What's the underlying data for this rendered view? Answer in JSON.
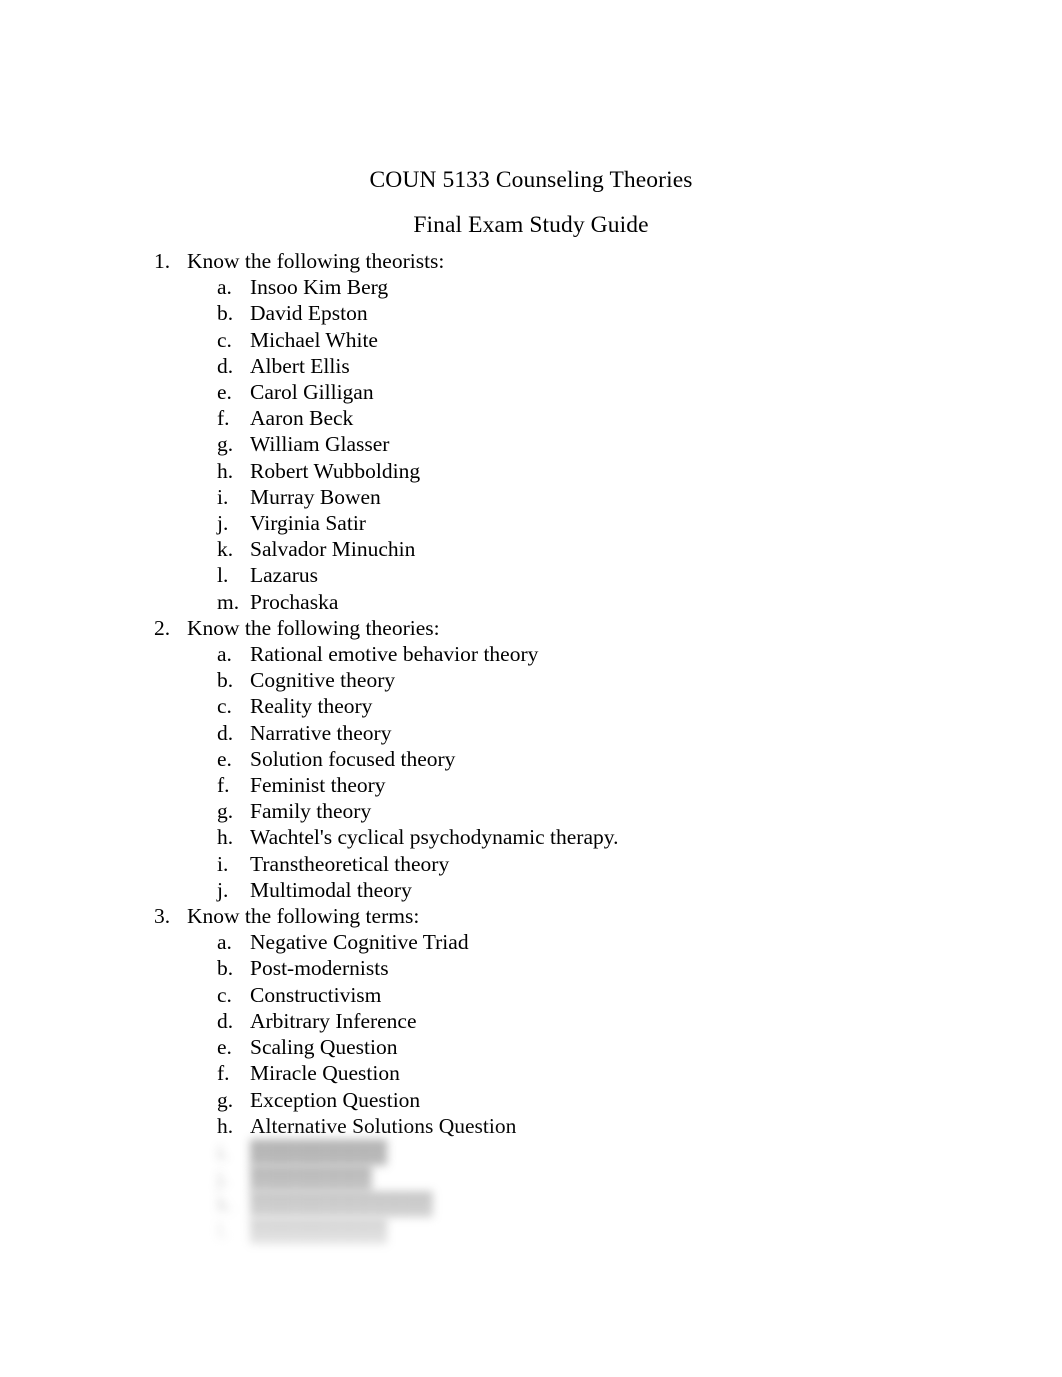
{
  "document": {
    "title": "COUN 5133 Counseling Theories",
    "subtitle": "Final Exam Study Guide",
    "page_background": "#ffffff",
    "text_color": "#000000",
    "obscured_text_color": "#7d7d7d"
  },
  "sections": [
    {
      "marker": "1.",
      "heading": "Know the following theorists:",
      "items": [
        {
          "marker": "a.",
          "label": "Insoo Kim Berg",
          "obscured": false
        },
        {
          "marker": "b.",
          "label": "David Epston",
          "obscured": false
        },
        {
          "marker": "c.",
          "label": "Michael White",
          "obscured": false
        },
        {
          "marker": "d.",
          "label": "Albert Ellis",
          "obscured": false
        },
        {
          "marker": "e.",
          "label": "Carol Gilligan",
          "obscured": false
        },
        {
          "marker": "f.",
          "label": "Aaron Beck",
          "obscured": false
        },
        {
          "marker": "g.",
          "label": "William Glasser",
          "obscured": false
        },
        {
          "marker": "h.",
          "label": "Robert Wubbolding",
          "obscured": false
        },
        {
          "marker": "i.",
          "label": "Murray Bowen",
          "obscured": false
        },
        {
          "marker": "j.",
          "label": "Virginia Satir",
          "obscured": false
        },
        {
          "marker": "k.",
          "label": "Salvador Minuchin",
          "obscured": false
        },
        {
          "marker": "l.",
          "label": "Lazarus",
          "obscured": false
        },
        {
          "marker": "m.",
          "label": "Prochaska",
          "obscured": false
        }
      ]
    },
    {
      "marker": "2.",
      "heading": "Know the following theories:",
      "items": [
        {
          "marker": "a.",
          "label": "Rational emotive behavior theory",
          "obscured": false
        },
        {
          "marker": "b.",
          "label": "Cognitive theory",
          "obscured": false
        },
        {
          "marker": "c.",
          "label": "Reality theory",
          "obscured": false
        },
        {
          "marker": "d.",
          "label": "Narrative theory",
          "obscured": false
        },
        {
          "marker": "e.",
          "label": "Solution focused theory",
          "obscured": false
        },
        {
          "marker": "f.",
          "label": "Feminist theory",
          "obscured": false
        },
        {
          "marker": "g.",
          "label": "Family theory",
          "obscured": false
        },
        {
          "marker": "h.",
          "label": "Wachtel's cyclical psychodynamic therapy.",
          "obscured": false
        },
        {
          "marker": "i.",
          "label": "Transtheoretical theory",
          "obscured": false
        },
        {
          "marker": "j.",
          "label": "Multimodal theory",
          "obscured": false
        }
      ]
    },
    {
      "marker": "3.",
      "heading": "Know the following terms:",
      "items": [
        {
          "marker": "a.",
          "label": "Negative Cognitive Triad",
          "obscured": false
        },
        {
          "marker": "b.",
          "label": "Post-modernists",
          "obscured": false
        },
        {
          "marker": "c.",
          "label": "Constructivism",
          "obscured": false
        },
        {
          "marker": "d.",
          "label": "Arbitrary Inference",
          "obscured": false
        },
        {
          "marker": "e.",
          "label": "Scaling Question",
          "obscured": false
        },
        {
          "marker": "f.",
          "label": "Miracle Question",
          "obscured": false
        },
        {
          "marker": "g.",
          "label": "Exception Question",
          "obscured": false
        },
        {
          "marker": "h.",
          "label": "Alternative Solutions Question",
          "obscured": false
        },
        {
          "marker": "i.",
          "label": "█████████",
          "obscured": true
        },
        {
          "marker": "j.",
          "label": "████████",
          "obscured": true
        },
        {
          "marker": "k.",
          "label": "████████████",
          "obscured": true
        },
        {
          "marker": "l.",
          "label": "█████████",
          "obscured": true
        }
      ]
    }
  ]
}
